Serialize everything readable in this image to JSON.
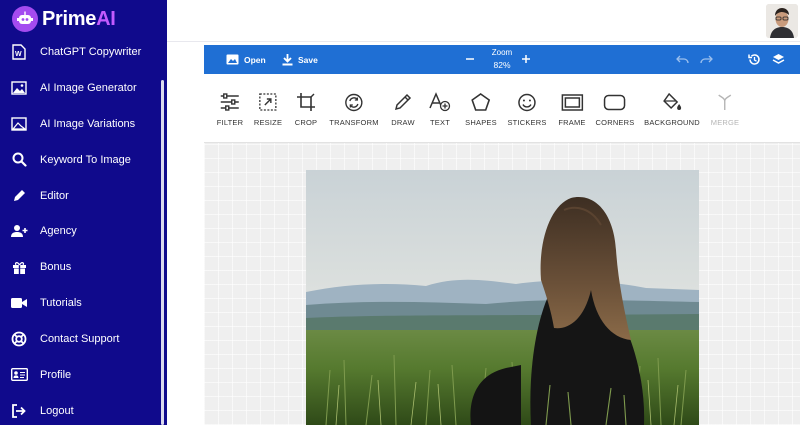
{
  "brand": {
    "prime": "Prime",
    "ai": "AI"
  },
  "sidebar": {
    "items": [
      {
        "label": "ChatGPT Copywriter",
        "icon": "document-w-icon"
      },
      {
        "label": "AI Image Generator",
        "icon": "image-icon"
      },
      {
        "label": "AI Image Variations",
        "icon": "image-variations-icon"
      },
      {
        "label": "Keyword To Image",
        "icon": "search-icon"
      },
      {
        "label": "Editor",
        "icon": "pencil-icon"
      },
      {
        "label": "Agency",
        "icon": "user-plus-icon"
      },
      {
        "label": "Bonus",
        "icon": "gift-icon"
      },
      {
        "label": "Tutorials",
        "icon": "video-camera-icon"
      },
      {
        "label": "Contact Support",
        "icon": "lifebuoy-icon"
      },
      {
        "label": "Profile",
        "icon": "id-card-icon"
      },
      {
        "label": "Logout",
        "icon": "logout-icon"
      }
    ]
  },
  "editor": {
    "open_label": "Open",
    "save_label": "Save",
    "zoom_label": "Zoom",
    "zoom_value": "82%",
    "tools": [
      {
        "label": "FILTER",
        "icon": "sliders-icon"
      },
      {
        "label": "RESIZE",
        "icon": "resize-icon"
      },
      {
        "label": "CROP",
        "icon": "crop-icon"
      },
      {
        "label": "TRANSFORM",
        "icon": "rotate-icon"
      },
      {
        "label": "DRAW",
        "icon": "pencil-icon"
      },
      {
        "label": "TEXT",
        "icon": "text-icon"
      },
      {
        "label": "SHAPES",
        "icon": "pentagon-icon"
      },
      {
        "label": "STICKERS",
        "icon": "smiley-icon"
      },
      {
        "label": "FRAME",
        "icon": "frame-icon"
      },
      {
        "label": "CORNERS",
        "icon": "rounded-rect-icon"
      },
      {
        "label": "BACKGROUND",
        "icon": "paint-bucket-icon"
      },
      {
        "label": "MERGE",
        "icon": "merge-icon"
      }
    ]
  },
  "colors": {
    "sidebar": "#100a8c",
    "accent": "#1f6fd4",
    "brand_ai": "#c25bff"
  }
}
